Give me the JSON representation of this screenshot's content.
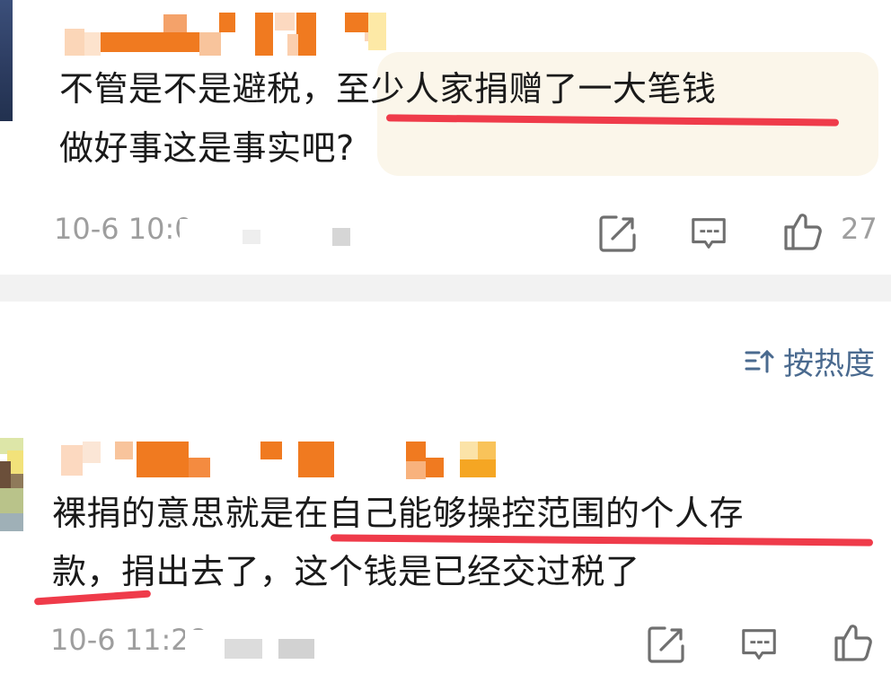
{
  "comments": [
    {
      "text_line1": "不管是不是避税，至少人家捐赠了一大笔钱",
      "text_line2": "做好事这是事实吧?",
      "timestamp": "10-6 10:0",
      "like_count": "27"
    },
    {
      "text_line1": "裸捐的意思就是在自己能够操控范围的个人存",
      "text_line2": "款，捐出去了，这个钱是已经交过税了",
      "timestamp": "10-6 11:28"
    }
  ],
  "sort": {
    "label": "按热度",
    "icon": "sort-icon"
  },
  "icons": {
    "repost": "repost-icon",
    "comment": "comment-icon",
    "like": "thumbs-up-icon"
  },
  "colors": {
    "highlight_underline": "#ef3b4a",
    "username_mosaic": "#f07a20",
    "meta_text": "#9e9e9e",
    "sort_accent": "#4a6a8f",
    "separator": "#f2f2f2"
  }
}
